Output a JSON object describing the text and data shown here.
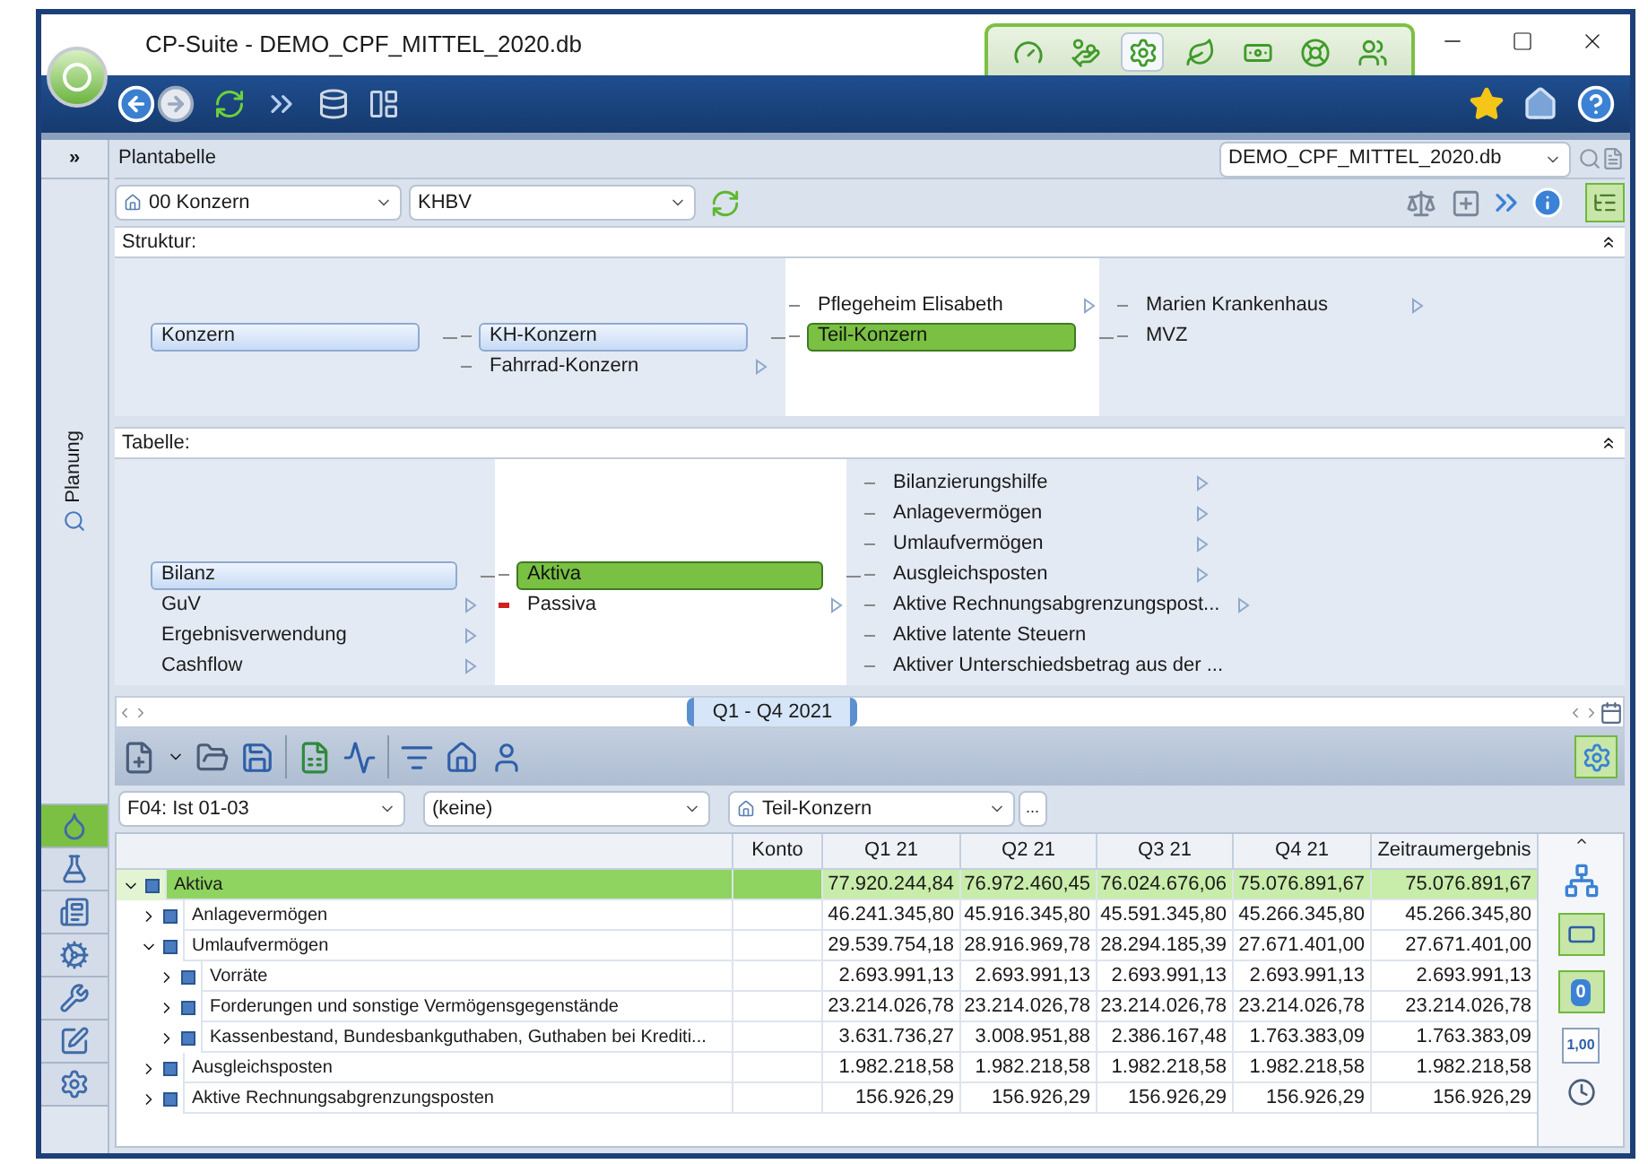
{
  "window": {
    "title": "CP-Suite - DEMO_CPF_MITTEL_2020.db"
  },
  "app_tabs": [
    {
      "selected": false
    },
    {
      "selected": false
    },
    {
      "selected": true
    },
    {
      "selected": false
    },
    {
      "selected": false
    },
    {
      "selected": false
    },
    {
      "selected": false
    }
  ],
  "sidebar": {
    "collapse": "»",
    "section": "Planung",
    "buttons": [
      {
        "selected": true
      },
      {
        "selected": false
      },
      {
        "selected": false
      },
      {
        "selected": false
      },
      {
        "selected": false
      },
      {
        "selected": false
      },
      {
        "selected": false
      }
    ]
  },
  "header": {
    "title": "Plantabelle",
    "database": "DEMO_CPF_MITTEL_2020.db"
  },
  "selectors": {
    "unit": "00 Konzern",
    "scheme": "KHBV"
  },
  "structure": {
    "label": "Struktur:",
    "columns": [
      {
        "items": [
          {
            "label": "Konzern",
            "selected": false,
            "in_path": true,
            "has_children": false,
            "marked": false
          }
        ]
      },
      {
        "items": [
          {
            "label": "KH-Konzern",
            "selected": false,
            "in_path": true,
            "has_children": false,
            "marked": false
          },
          {
            "label": "Fahrrad-Konzern",
            "selected": false,
            "in_path": false,
            "has_children": true,
            "marked": false
          }
        ]
      },
      {
        "items": [
          {
            "label": "Pflegeheim Elisabeth",
            "selected": false,
            "in_path": false,
            "has_children": true,
            "marked": false
          },
          {
            "label": "Teil-Konzern",
            "selected": true,
            "in_path": false,
            "has_children": false,
            "marked": false
          }
        ]
      },
      {
        "items": [
          {
            "label": "Marien Krankenhaus",
            "selected": false,
            "in_path": false,
            "has_children": true,
            "marked": false
          },
          {
            "label": "MVZ",
            "selected": false,
            "in_path": false,
            "has_children": false,
            "marked": false
          }
        ]
      }
    ]
  },
  "table_tree": {
    "label": "Tabelle:",
    "columns": [
      {
        "items": [
          {
            "label": "Bilanz",
            "selected": false,
            "in_path": true,
            "has_children": false,
            "marked": false
          },
          {
            "label": "GuV",
            "selected": false,
            "in_path": false,
            "has_children": true,
            "marked": false
          },
          {
            "label": "Ergebnisverwendung",
            "selected": false,
            "in_path": false,
            "has_children": true,
            "marked": false
          },
          {
            "label": "Cashflow",
            "selected": false,
            "in_path": false,
            "has_children": true,
            "marked": false
          }
        ]
      },
      {
        "items": [
          {
            "label": "Aktiva",
            "selected": true,
            "in_path": false,
            "has_children": false,
            "marked": false
          },
          {
            "label": "Passiva",
            "selected": false,
            "in_path": false,
            "has_children": true,
            "marked": true
          }
        ]
      },
      {
        "items": [
          {
            "label": "Bilanzierungshilfe",
            "selected": false,
            "in_path": false,
            "has_children": true,
            "marked": false
          },
          {
            "label": "Anlagevermögen",
            "selected": false,
            "in_path": false,
            "has_children": true,
            "marked": false
          },
          {
            "label": "Umlaufvermögen",
            "selected": false,
            "in_path": false,
            "has_children": true,
            "marked": false
          },
          {
            "label": "Ausgleichsposten",
            "selected": false,
            "in_path": false,
            "has_children": true,
            "marked": false
          },
          {
            "label": "Aktive Rechnungsabgrenzungspost...",
            "selected": false,
            "in_path": false,
            "has_children": true,
            "marked": false
          },
          {
            "label": "Aktive latente Steuern",
            "selected": false,
            "in_path": false,
            "has_children": false,
            "marked": false
          },
          {
            "label": "Aktiver Unterschiedsbetrag aus der ...",
            "selected": false,
            "in_path": false,
            "has_children": false,
            "marked": false
          }
        ]
      }
    ]
  },
  "timeline": {
    "period": "Q1 - Q4 2021"
  },
  "filters": {
    "version": "F04: Ist 01-03",
    "comparison": "(keine)",
    "unit": "Teil-Konzern",
    "more": "..."
  },
  "grid": {
    "columns": [
      "Konto",
      "Q1 21",
      "Q2 21",
      "Q3 21",
      "Q4 21",
      "Zeitraumergebnis"
    ],
    "rows": [
      {
        "label": "Aktiva",
        "selected": true,
        "expanded": true,
        "values": [
          "77.920.244,84",
          "76.972.460,45",
          "76.024.676,06",
          "75.076.891,67",
          "75.076.891,67"
        ],
        "children": [
          {
            "label": "Anlagevermögen",
            "selected": false,
            "expanded": false,
            "values": [
              "46.241.345,80",
              "45.916.345,80",
              "45.591.345,80",
              "45.266.345,80",
              "45.266.345,80"
            ]
          },
          {
            "label": "Umlaufvermögen",
            "selected": false,
            "expanded": true,
            "values": [
              "29.539.754,18",
              "28.916.969,78",
              "28.294.185,39",
              "27.671.401,00",
              "27.671.401,00"
            ],
            "children": [
              {
                "label": "Vorräte",
                "selected": false,
                "expanded": false,
                "values": [
                  "2.693.991,13",
                  "2.693.991,13",
                  "2.693.991,13",
                  "2.693.991,13",
                  "2.693.991,13"
                ]
              },
              {
                "label": "Forderungen und sonstige Vermögensgegenstände",
                "selected": false,
                "expanded": false,
                "values": [
                  "23.214.026,78",
                  "23.214.026,78",
                  "23.214.026,78",
                  "23.214.026,78",
                  "23.214.026,78"
                ]
              },
              {
                "label": "Kassenbestand, Bundesbankguthaben, Guthaben bei Krediti...",
                "selected": false,
                "expanded": false,
                "values": [
                  "3.631.736,27",
                  "3.008.951,88",
                  "2.386.167,48",
                  "1.763.383,09",
                  "1.763.383,09"
                ]
              }
            ]
          },
          {
            "label": "Ausgleichsposten",
            "selected": false,
            "expanded": false,
            "values": [
              "1.982.218,58",
              "1.982.218,58",
              "1.982.218,58",
              "1.982.218,58",
              "1.982.218,58"
            ]
          },
          {
            "label": "Aktive Rechnungsabgrenzungsposten",
            "selected": false,
            "expanded": false,
            "values": [
              "156.926,29",
              "156.926,29",
              "156.926,29",
              "156.926,29",
              "156.926,29"
            ]
          }
        ]
      }
    ]
  },
  "side_panel": {
    "zero": "0",
    "decimal": "1,00"
  }
}
